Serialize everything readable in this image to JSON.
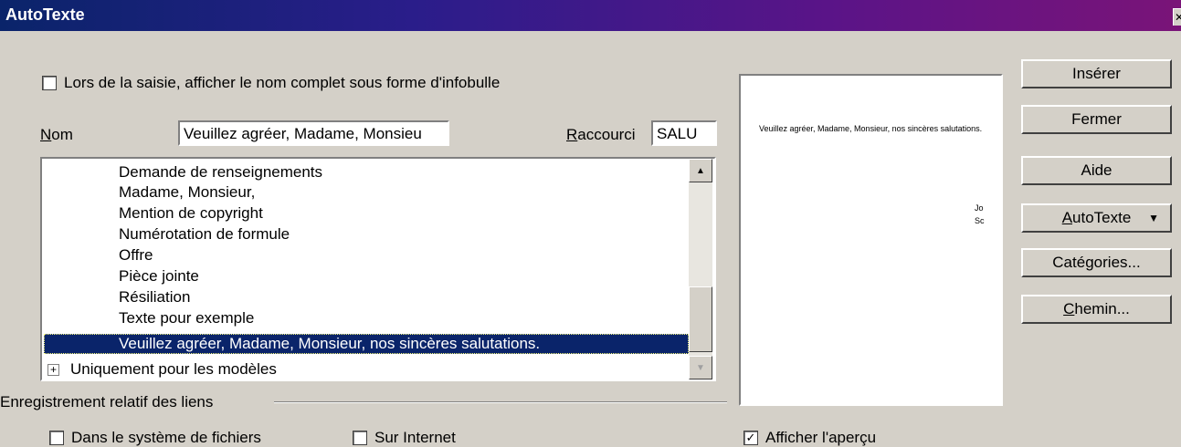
{
  "window": {
    "title": "AutoTexte",
    "close": "✕"
  },
  "tooltip_option": {
    "label": "Lors de la saisie, afficher le nom complet sous forme d'infobulle",
    "checked": false
  },
  "name_field": {
    "label": "Nom",
    "value": "Veuillez agréer, Madame, Monsieu"
  },
  "shortcut_field": {
    "label": "Raccourci",
    "value": "SALU"
  },
  "list": {
    "items": [
      "Demande de renseignements",
      "Madame, Monsieur,",
      "Mention de copyright",
      "Numérotation de formule",
      "Offre",
      "Pièce jointe",
      "Résiliation",
      "Texte pour exemple",
      "Veuillez agréer, Madame, Monsieur, nos sincères salutations."
    ],
    "selected_index": 8,
    "group": "Uniquement pour les modèles"
  },
  "preview": {
    "text": "Veuillez agréer, Madame, Monsieur, nos sincères salutations.",
    "cut_line1": "Jo",
    "cut_line2": "Sc"
  },
  "buttons": {
    "insert": "Insérer",
    "close": "Fermer",
    "help": "Aide",
    "autotext": "AutoTexte",
    "categories": "Catégories...",
    "path": "Chemin..."
  },
  "links_group": {
    "label": "Enregistrement relatif des liens",
    "filesystem": "Dans le système de fichiers",
    "internet": "Sur Internet"
  },
  "show_preview": {
    "label": "Afficher l'aperçu",
    "checked": true
  }
}
